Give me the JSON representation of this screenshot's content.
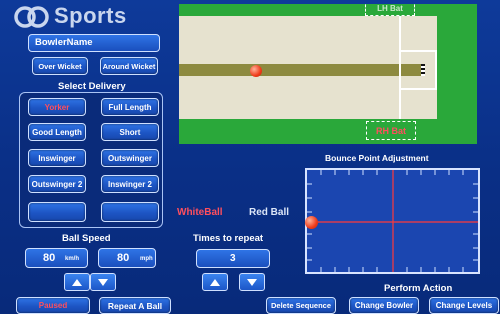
{
  "brand": {
    "logo_text": "Sports"
  },
  "bowler": {
    "name": "BowlerName"
  },
  "wicket": {
    "over": "Over Wicket",
    "around": "Around Wicket"
  },
  "select_delivery": {
    "title": "Select Delivery",
    "options": [
      "Yorker",
      "Full Length",
      "Good Length",
      "Short",
      "Inswinger",
      "Outswinger",
      "Outswinger 2",
      "Inswinger 2",
      "",
      ""
    ],
    "selected_color": "#ff4f5e"
  },
  "pitch_view": {
    "lh_bat": "LH Bat",
    "rh_bat": "RH Bat"
  },
  "ball_colour": {
    "white": "WhiteBall",
    "red": "Red Ball"
  },
  "bounce": {
    "title": "Bounce Point Adjustment"
  },
  "ball_speed": {
    "title": "Ball Speed",
    "kmh_value": "80",
    "kmh_unit": "km/h",
    "mph_value": "80",
    "mph_unit": "mph"
  },
  "repeat": {
    "title": "Times to repeat",
    "value": "3"
  },
  "perform": {
    "title": "Perform Action"
  },
  "bottom_buttons": {
    "paused": "Paused",
    "repeat_ball": "Repeat A Ball",
    "delete_sequence": "Delete Sequence",
    "change_bowler": "Change Bowler",
    "change_levels": "Change Levels"
  }
}
